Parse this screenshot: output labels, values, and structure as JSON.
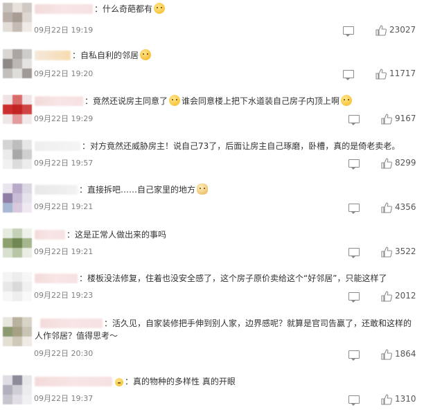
{
  "comments": [
    {
      "sep": "：",
      "text": "什么奇葩都有",
      "time": "09月22日 19:19",
      "likes": "23027",
      "emoji": "sweat"
    },
    {
      "sep": "：",
      "text": "自私自利的邻居",
      "time": "09月22日 19:20",
      "likes": "11717",
      "emoji": "cry"
    },
    {
      "sep": "：",
      "text": "竟然还说房主同意了",
      "text2": "谁会同意楼上把下水道装自己房子内顶上啊",
      "time": "09月22日 19:29",
      "likes": "9167"
    },
    {
      "sep": "：",
      "text": "对方竟然还威胁房主！说自己73了，后面让房主自己琢磨，卧槽，真的是倚老卖老。",
      "time": "09月22日 19:57",
      "likes": "8299"
    },
    {
      "sep": "：",
      "text": "直接拆吧……自己家里的地方",
      "time": "09月22日 19:21",
      "likes": "4356"
    },
    {
      "sep": "：",
      "text": "这是正常人做出来的事吗",
      "time": "09月22日 19:21",
      "likes": "3522"
    },
    {
      "sep": "：",
      "text": "楼板没法修复，住着也没安全感了，这个房子原价卖给这个“好邻居”，只能这样了",
      "time": "09月22日 19:23",
      "likes": "2012"
    },
    {
      "sep": "：",
      "text": "活久见，自家装修把手伸到别人家，边界感呢？就算是官司告赢了，还敢和这样的",
      "text2": "人作邻居？值得思考～",
      "time": "09月22日 20:30",
      "likes": "1864"
    },
    {
      "sep": "：",
      "text": "真的物种的多样性 真的开眼",
      "time": "09月22日 19:37",
      "likes": "1310"
    }
  ],
  "colors": {
    "text": "#333333",
    "time": "#808080",
    "icon": "#8a8a8a"
  }
}
